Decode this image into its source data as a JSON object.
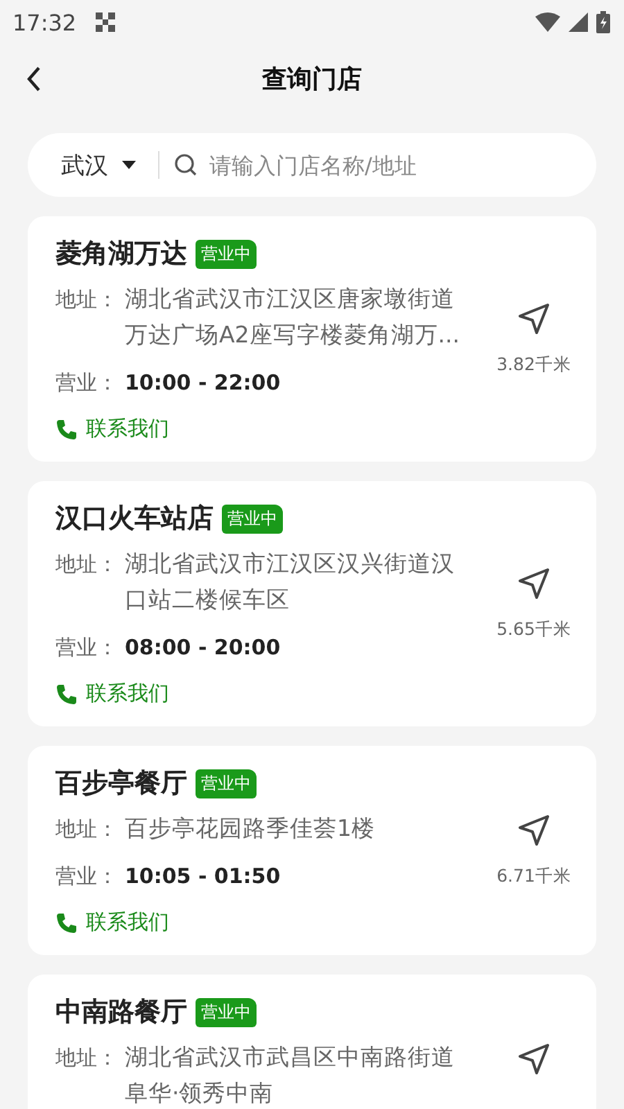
{
  "status_bar": {
    "time": "17:32"
  },
  "header": {
    "title": "查询门店"
  },
  "search": {
    "city": "武汉",
    "placeholder": "请输入门店名称/地址"
  },
  "stores": [
    {
      "name": "菱角湖万达",
      "status": "营业中",
      "open": true,
      "address_label": "地址：",
      "address_lines": [
        "湖北省武汉市江汉区唐家墩街道",
        "万达广场A2座写字楼菱角湖万..."
      ],
      "hours_label": "营业：",
      "hours": "10:00 - 22:00",
      "distance": "3.82千米",
      "contact": "联系我们"
    },
    {
      "name": "汉口火车站店",
      "status": "营业中",
      "open": true,
      "address_label": "地址：",
      "address_lines": [
        "湖北省武汉市江汉区汉兴街道汉",
        "口站二楼候车区"
      ],
      "hours_label": "营业：",
      "hours": "08:00 - 20:00",
      "distance": "5.65千米",
      "contact": "联系我们"
    },
    {
      "name": "百步亭餐厅",
      "status": "营业中",
      "open": true,
      "address_label": "地址：",
      "address_lines": [
        "百步亭花园路季佳荟1楼"
      ],
      "hours_label": "营业：",
      "hours": "10:05 - 01:50",
      "distance": "6.71千米",
      "contact": "联系我们"
    },
    {
      "name": "中南路餐厅",
      "status": "营业中",
      "open": true,
      "address_label": "地址：",
      "address_lines": [
        "湖北省武汉市武昌区中南路街道",
        "阜华·领秀中南"
      ]
    }
  ]
}
